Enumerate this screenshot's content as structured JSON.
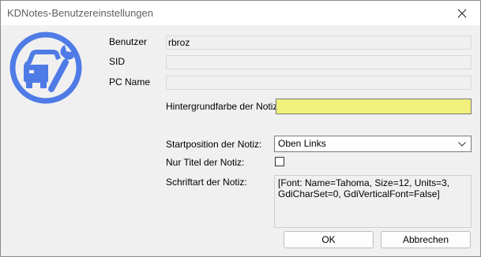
{
  "window": {
    "title": "KDNotes-Benutzereinstellungen",
    "close_icon": "close-icon"
  },
  "logo": {
    "icon": "car-wrench-icon",
    "color": "#4f7be6"
  },
  "fields": {
    "benutzer": {
      "label": "Benutzer",
      "value": "rbroz"
    },
    "sid": {
      "label": "SID",
      "value": ""
    },
    "pc_name": {
      "label": "PC Name",
      "value": ""
    }
  },
  "hintergrundfarbe": {
    "label": "Hintergrundfarbe der Notiz:",
    "color": "#f1f07c"
  },
  "startposition": {
    "label": "Startposition der Notiz:",
    "selected": "Oben Links"
  },
  "nur_titel": {
    "label": "Nur Titel der Notiz:",
    "checked": false
  },
  "schriftart": {
    "label": "Schriftart der Notiz:",
    "value": "[Font: Name=Tahoma, Size=12, Units=3, GdiCharSet=0, GdiVerticalFont=False]"
  },
  "buttons": {
    "ok": "OK",
    "cancel": "Abbrechen"
  }
}
